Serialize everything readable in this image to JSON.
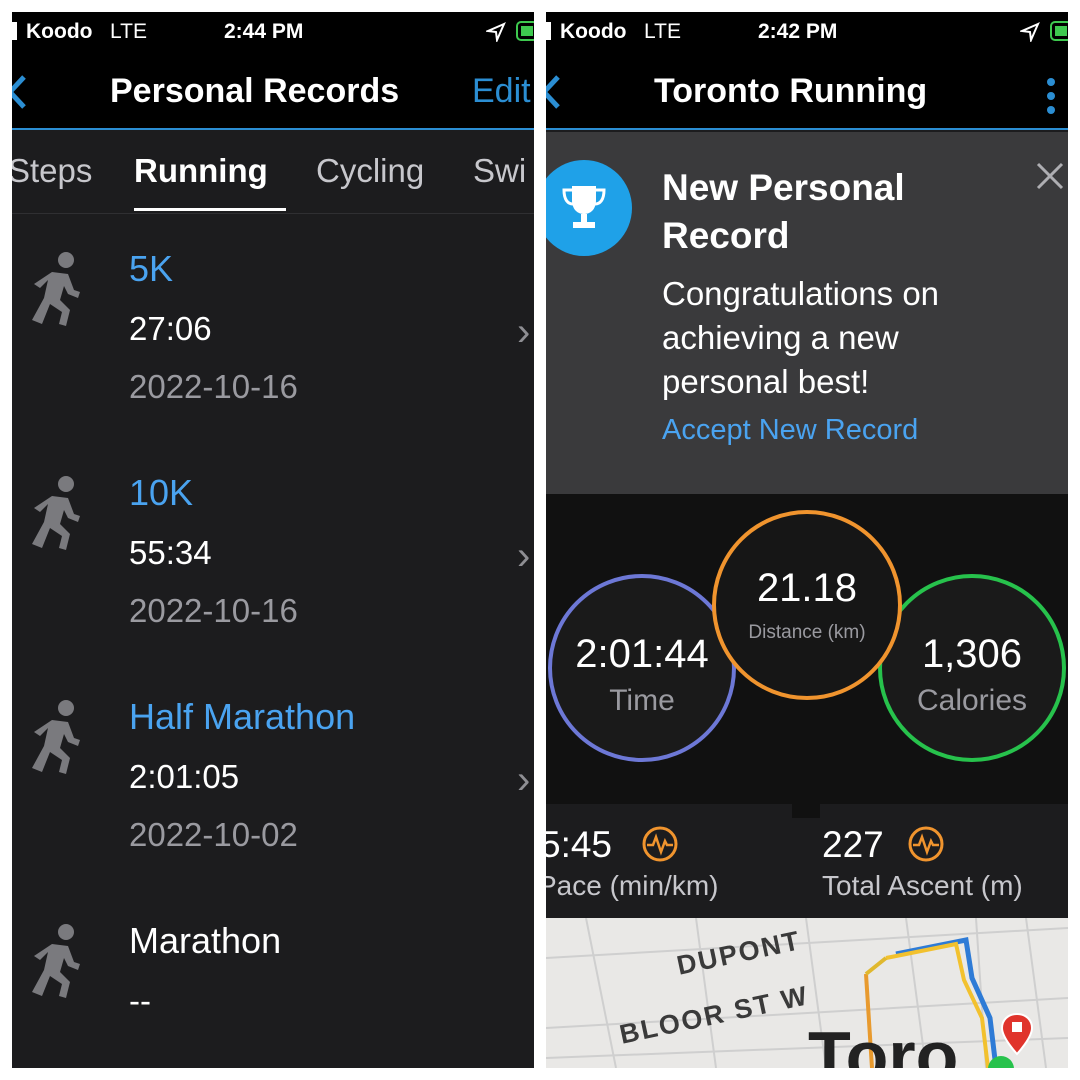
{
  "left": {
    "status": {
      "carrier": "Koodo",
      "network": "LTE",
      "time": "2:44 PM"
    },
    "nav": {
      "title": "Personal Records",
      "edit_label": "Edit"
    },
    "tabs": [
      "Steps",
      "Running",
      "Cycling",
      "Swi"
    ],
    "active_tab": "Running",
    "records": [
      {
        "name": "5K",
        "time": "27:06",
        "date": "2022-10-16"
      },
      {
        "name": "10K",
        "time": "55:34",
        "date": "2022-10-16"
      },
      {
        "name": "Half Marathon",
        "time": "2:01:05",
        "date": "2022-10-02"
      },
      {
        "name": "Marathon",
        "time": "--"
      }
    ],
    "icons": {
      "record": "running-person-icon",
      "row_chevron": "chevron-right-icon",
      "back": "chevron-left-icon"
    }
  },
  "right": {
    "status": {
      "carrier": "Koodo",
      "network": "LTE",
      "time": "2:42 PM"
    },
    "nav": {
      "title": "Toronto Running"
    },
    "banner": {
      "title": "New Personal Record",
      "message": "Congratulations on achieving a new personal best!",
      "link": "Accept New Record"
    },
    "stats": {
      "time": {
        "value": "2:01:44",
        "label": "Time"
      },
      "distance": {
        "value": "21.18",
        "label": "Distance (km)"
      },
      "calories": {
        "value": "1,306",
        "label": "Calories"
      }
    },
    "metrics": [
      {
        "value": "5:45",
        "label": "Pace (min/km)"
      },
      {
        "value": "227",
        "label": "Total Ascent (m)"
      }
    ],
    "map": {
      "street1": "DUPONT",
      "street2": "BLOOR ST W",
      "city": "Toro"
    },
    "colors": {
      "accent_blue": "#4aa3f0",
      "time_ring": "#7d6fd6",
      "distance_ring": "#f0942e",
      "calories_ring": "#27c24c",
      "metric_icon": "#f0942e"
    }
  }
}
